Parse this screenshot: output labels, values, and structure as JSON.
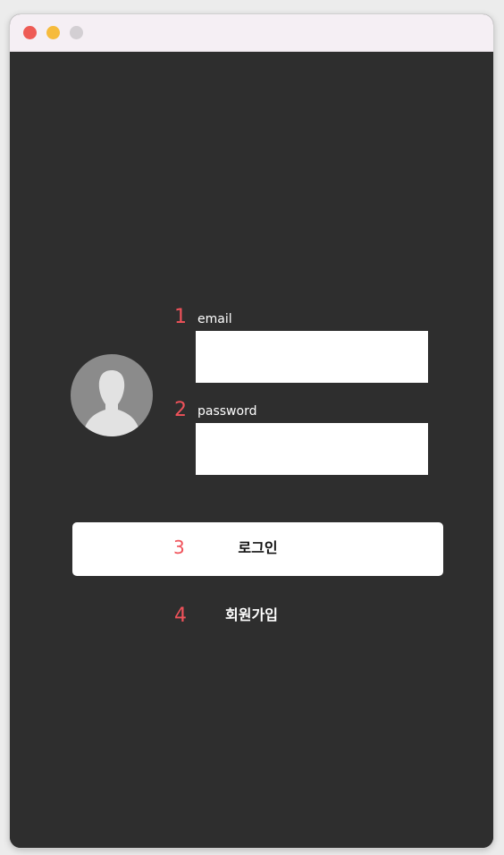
{
  "window": {
    "controls": {
      "close_color": "#ee5b55",
      "minimize_color": "#f6bb3c",
      "maximize_color": "#d3cfd3"
    }
  },
  "form": {
    "annotations": [
      "1",
      "2",
      "3",
      "4"
    ],
    "email": {
      "label": "email",
      "value": "",
      "placeholder": ""
    },
    "password": {
      "label": "password",
      "value": "",
      "placeholder": ""
    },
    "login_button_label": "로그인",
    "signup_link_label": "회원가입",
    "avatar_icon": "user-silhouette-icon"
  },
  "colors": {
    "background": "#2e2e2e",
    "annotation": "#f0525a",
    "button": "#ffffff"
  }
}
